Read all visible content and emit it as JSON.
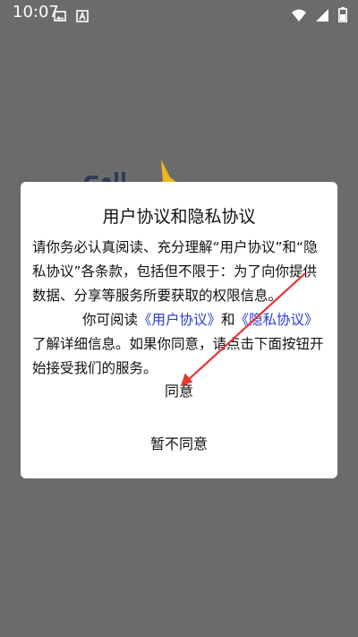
{
  "status_bar": {
    "time": "10:07",
    "left_icons": [
      "image-icon",
      "a-app-icon"
    ],
    "right_icons": [
      "wifi-icon",
      "signal-icon",
      "battery-icon"
    ]
  },
  "dialog": {
    "title": "用户协议和隐私协议",
    "body": {
      "p1": "请你务必认真阅读、充分理解“用户协议”和“隐私协议”各条款，包括但不限于：为了向你提供数据、分享等服务所要获取的权限信息。",
      "p2_prefix": "你可阅读",
      "link_user_agreement": "《用户协议》",
      "p2_and": "和",
      "link_privacy_agreement": "《隐私协议》",
      "p2_suffix": "了解详细信息。如果你同意，请点击下面按钮开始接受我们的服务。"
    },
    "agree_label": "同意",
    "disagree_label": "暂不同意"
  },
  "colors": {
    "overlay": "#6b6b6b",
    "link": "#2b3bd6",
    "annotation_arrow": "#e53935",
    "logo_accent": "#f2b51c"
  }
}
